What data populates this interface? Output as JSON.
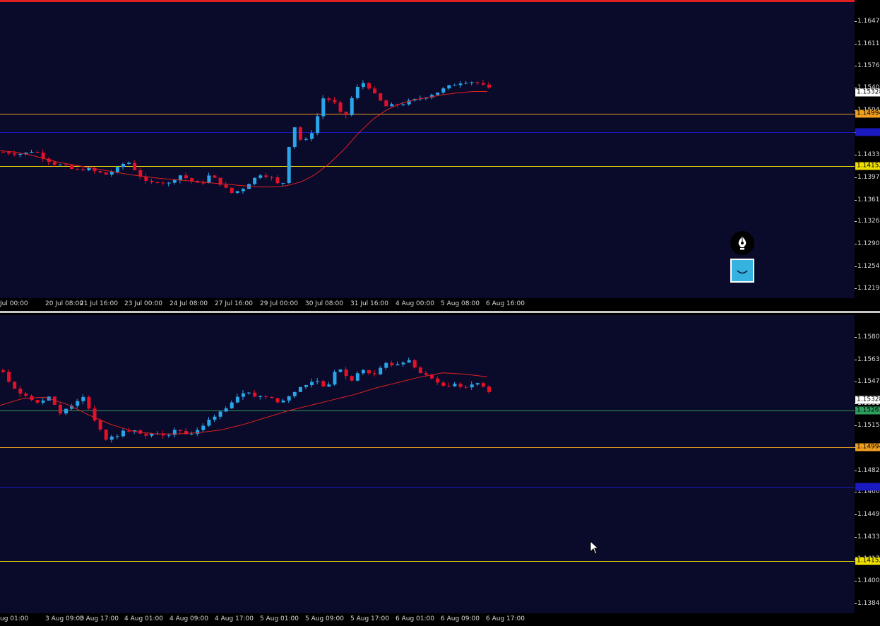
{
  "colors": {
    "background": "#0a0a2b",
    "bull_candle": "#2aa6e8",
    "bear_candle": "#e3102a",
    "moving_average": "#e02020",
    "level_orange": "#f0a020",
    "level_blue": "#1a1ac0",
    "level_yellow": "#f0e000",
    "level_green": "#2e9e5e",
    "window_border_active": "#e02020"
  },
  "charts": [
    {
      "name": "upper",
      "y_min": 1.12197,
      "y_max": 1.16657,
      "y_ticks": [
        "1.16477",
        "1.16117",
        "1.15767",
        "1.15407",
        "1.15047",
        "1.14697",
        "1.14337",
        "1.13977",
        "1.13617",
        "1.13267",
        "1.12907",
        "1.12547",
        "1.12197"
      ],
      "tick_values": [
        1.16477,
        1.16117,
        1.15767,
        1.15407,
        1.15047,
        1.14697,
        1.14337,
        1.13977,
        1.13617,
        1.13267,
        1.12907,
        1.12547,
        1.12197
      ],
      "x_labels": [
        "Jul 00:00",
        "20 Jul 08:00",
        "21 Jul 16:00",
        "23 Jul 00:00",
        "24 Jul 08:00",
        "27 Jul 16:00",
        "29 Jul 00:00",
        "30 Jul 08:00",
        "31 Jul 16:00",
        "4 Aug 00:00",
        "5 Aug 08:00",
        "6 Aug 16:00"
      ],
      "price_tags": [
        {
          "label": "1.15328",
          "value": 1.15328,
          "bg": "#ffffff",
          "fg": "#000000"
        },
        {
          "label": "1.14994",
          "value": 1.14994,
          "bg": "#f0a020",
          "fg": "#000000"
        },
        {
          "label": "1.14702",
          "value": 1.14702,
          "bg": "#1a1ac0",
          "fg": "#1a1ac0"
        },
        {
          "label": "1.14152",
          "value": 1.14152,
          "bg": "#f0e000",
          "fg": "#000000"
        }
      ],
      "levels": [
        {
          "value": 1.14994,
          "color": "#f0a020"
        },
        {
          "value": 1.14702,
          "color": "#1a1ac0"
        },
        {
          "value": 1.14152,
          "color": "#f0e000"
        }
      ],
      "path": [
        1.1438,
        1.1436,
        1.1435,
        1.1441,
        1.1428,
        1.1419,
        1.1415,
        1.1408,
        1.1412,
        1.1406,
        1.1402,
        1.1411,
        1.1424,
        1.1405,
        1.1386,
        1.1392,
        1.1387,
        1.1402,
        1.1394,
        1.1385,
        1.1401,
        1.1388,
        1.1372,
        1.1377,
        1.1392,
        1.1404,
        1.1396,
        1.1379,
        1.1486,
        1.1449,
        1.1474,
        1.1526,
        1.1518,
        1.1489,
        1.1537,
        1.1551,
        1.1528,
        1.1511,
        1.1513,
        1.1517,
        1.1522,
        1.1528,
        1.1534,
        1.1542,
        1.1549,
        1.1552,
        1.1548,
        1.1539
      ],
      "ma": [
        1.144,
        1.1438,
        1.1434,
        1.1428,
        1.1422,
        1.1418,
        1.1414,
        1.141,
        1.1406,
        1.1402,
        1.1399,
        1.1396,
        1.1394,
        1.1392,
        1.139,
        1.1388,
        1.1386,
        1.1384,
        1.1382,
        1.1382,
        1.1384,
        1.139,
        1.1402,
        1.142,
        1.1442,
        1.1468,
        1.149,
        1.1506,
        1.1516,
        1.1522,
        1.1526,
        1.153,
        1.1533,
        1.1535,
        1.1535
      ],
      "ma_x0": 0,
      "ma_x1": 690,
      "candles_x0": 2,
      "candles_x1": 690
    },
    {
      "name": "lower",
      "y_min": 1.13842,
      "y_max": 1.15892,
      "y_ticks": [
        "1.15802",
        "1.15637",
        "1.15477",
        "1.15317",
        "1.15152",
        "1.14994",
        "1.14822",
        "1.14662",
        "1.14497",
        "1.14332",
        "1.14172",
        "1.14007",
        "1.13842"
      ],
      "tick_values": [
        1.15802,
        1.15637,
        1.15477,
        1.15317,
        1.15152,
        1.14994,
        1.14822,
        1.14662,
        1.14497,
        1.14332,
        1.14172,
        1.14007,
        1.13842
      ],
      "x_labels": [
        "ug 01:00",
        "3 Aug 09:00",
        "3 Aug 17:00",
        "4 Aug 01:00",
        "4 Aug 09:00",
        "4 Aug 17:00",
        "5 Aug 01:00",
        "5 Aug 09:00",
        "5 Aug 17:00",
        "6 Aug 01:00",
        "6 Aug 09:00",
        "6 Aug 17:00"
      ],
      "price_tags": [
        {
          "label": "1.15328",
          "value": 1.15338,
          "bg": "#ffffff",
          "fg": "#000000"
        },
        {
          "label": "1.15263",
          "value": 1.15263,
          "bg": "#2e9e5e",
          "fg": "#000000"
        },
        {
          "label": "1.14994",
          "value": 1.14994,
          "bg": "#f0a020",
          "fg": "#000000"
        },
        {
          "label": "1.14702",
          "value": 1.14702,
          "bg": "#1a1ac0",
          "fg": "#1a1ac0"
        },
        {
          "label": "1.14152",
          "value": 1.14152,
          "bg": "#f0e000",
          "fg": "#000000"
        }
      ],
      "levels": [
        {
          "value": 1.15263,
          "color": "#2e9e5e"
        },
        {
          "value": 1.14994,
          "color": "#f0a020"
        },
        {
          "value": 1.14702,
          "color": "#1a1ac0"
        },
        {
          "value": 1.14152,
          "color": "#f0e000"
        }
      ],
      "path": [
        1.1556,
        1.1541,
        1.1538,
        1.1531,
        1.1537,
        1.1524,
        1.153,
        1.1536,
        1.1518,
        1.1504,
        1.1509,
        1.1512,
        1.1508,
        1.151,
        1.1506,
        1.1514,
        1.1508,
        1.1512,
        1.1521,
        1.1527,
        1.1534,
        1.1539,
        1.1536,
        1.1538,
        1.1531,
        1.154,
        1.1545,
        1.1549,
        1.1543,
        1.1559,
        1.1548,
        1.1556,
        1.1553,
        1.1561,
        1.1559,
        1.1563,
        1.1555,
        1.1549,
        1.1544,
        1.1546,
        1.1542,
        1.1547,
        1.1539
      ],
      "ma": [
        1.153,
        1.1535,
        1.1536,
        1.1531,
        1.1523,
        1.1516,
        1.1511,
        1.1509,
        1.1509,
        1.151,
        1.1512,
        1.1516,
        1.1521,
        1.1526,
        1.153,
        1.1534,
        1.1538,
        1.1543,
        1.1547,
        1.1551,
        1.1554,
        1.1553,
        1.1551
      ],
      "ma_x0": 0,
      "ma_x1": 690,
      "candles_x0": 2,
      "candles_x1": 690
    }
  ],
  "toolbar": {
    "pen_icon": "fountain-pen-icon",
    "smile_icon": "smile-icon"
  }
}
